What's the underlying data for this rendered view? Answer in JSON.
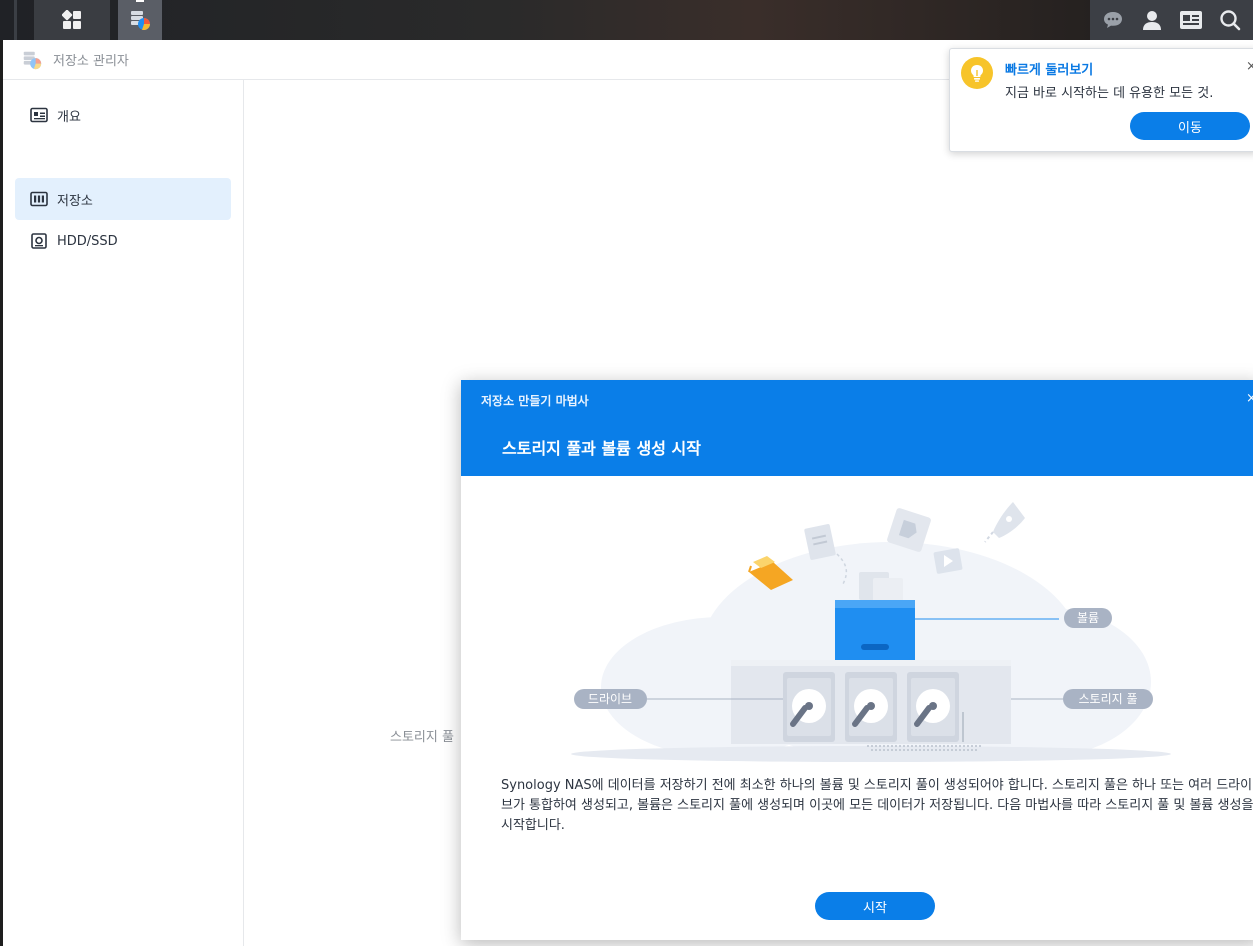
{
  "app": {
    "title": "저장소 관리자"
  },
  "sidebar": {
    "items": [
      {
        "label": "개요",
        "icon": "overview-icon",
        "active": false
      },
      {
        "label": "저장소",
        "icon": "storage-icon",
        "active": true
      },
      {
        "label": "HDD/SSD",
        "icon": "hdd-icon",
        "active": false
      }
    ]
  },
  "content": {
    "hint": "스토리지 풀"
  },
  "toast": {
    "title": "빠르게 둘러보기",
    "message": "지금 바로 시작하는 데 유용한 모든 것.",
    "button": "이동",
    "close": "×",
    "icon": "lightbulb-icon"
  },
  "wizard": {
    "window_title": "저장소 만들기 마법사",
    "heading": "스토리지 풀과 볼륨 생성 시작",
    "close": "×",
    "illustration": {
      "label_volume": "볼륨",
      "label_drive": "드라이브",
      "label_pool": "스토리지 풀"
    },
    "description": "Synology NAS에 데이터를 저장하기 전에 최소한 하나의 볼륨 및 스토리지 풀이 생성되어야 합니다. 스토리지 풀은 하나 또는 여러 드라이브가 통합하여 생성되고, 볼륨은 스토리지 풀에 생성되며 이곳에 모든 데이터가 저장됩니다. 다음 마법사를 따라 스토리지 풀 및 볼륨 생성을 시작합니다.",
    "start_button": "시작"
  },
  "colors": {
    "accent": "#0a7ee8",
    "active_bg": "#e3f0fd",
    "bulb": "#f7c42a",
    "label_pill": "#a9b3c4"
  }
}
